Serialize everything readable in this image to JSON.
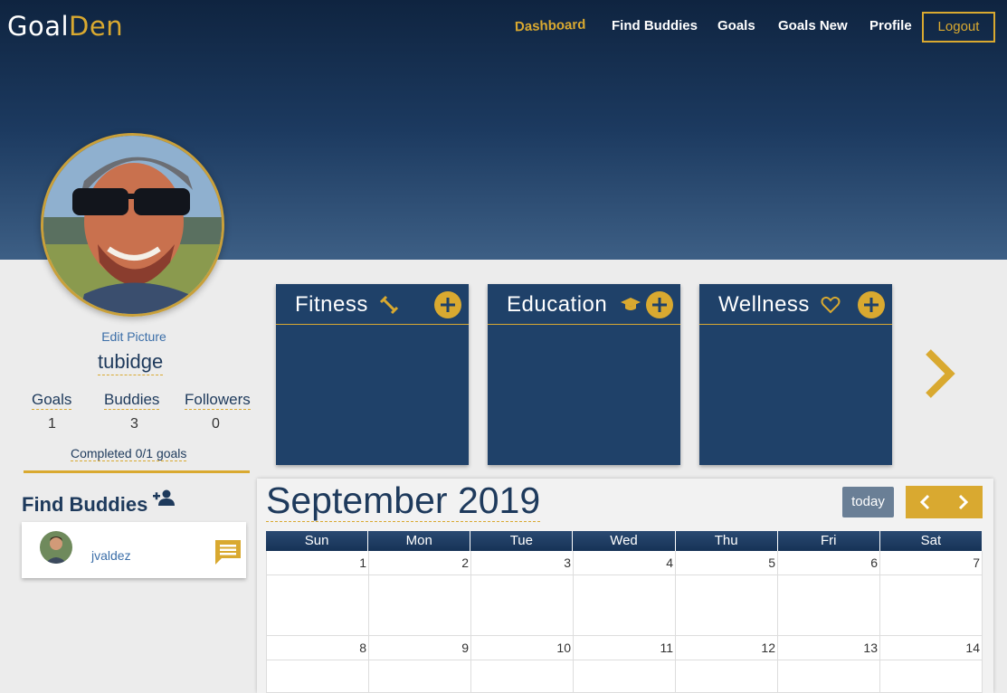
{
  "brand": {
    "part1": "Goal",
    "part2": "Den"
  },
  "nav": {
    "items": [
      {
        "label": "Dashboard",
        "active": true
      },
      {
        "label": "Find Buddies"
      },
      {
        "label": "Goals"
      },
      {
        "label": "Goals New"
      },
      {
        "label": "Profile"
      }
    ],
    "logout": "Logout"
  },
  "profile": {
    "edit_picture": "Edit Picture",
    "username": "tubidge",
    "stats": [
      {
        "label": "Goals",
        "value": "1"
      },
      {
        "label": "Buddies",
        "value": "3"
      },
      {
        "label": "Followers",
        "value": "0"
      }
    ],
    "completed": "Completed 0/1 goals"
  },
  "find_buddies": {
    "title": "Find Buddies",
    "buddies": [
      {
        "name": "jvaldez"
      }
    ]
  },
  "goal_categories": [
    {
      "title": "Fitness",
      "icon": "dumbbell-icon"
    },
    {
      "title": "Education",
      "icon": "graduation-cap-icon"
    },
    {
      "title": "Wellness",
      "icon": "heart-icon"
    }
  ],
  "calendar": {
    "title": "September 2019",
    "today_label": "today",
    "weekdays": [
      "Sun",
      "Mon",
      "Tue",
      "Wed",
      "Thu",
      "Fri",
      "Sat"
    ],
    "weeks": [
      [
        "1",
        "2",
        "3",
        "4",
        "5",
        "6",
        "7"
      ],
      [
        "8",
        "9",
        "10",
        "11",
        "12",
        "13",
        "14"
      ]
    ]
  },
  "colors": {
    "accent": "#d9a930",
    "navy": "#1f4169",
    "header_dark": "#0f2440"
  }
}
